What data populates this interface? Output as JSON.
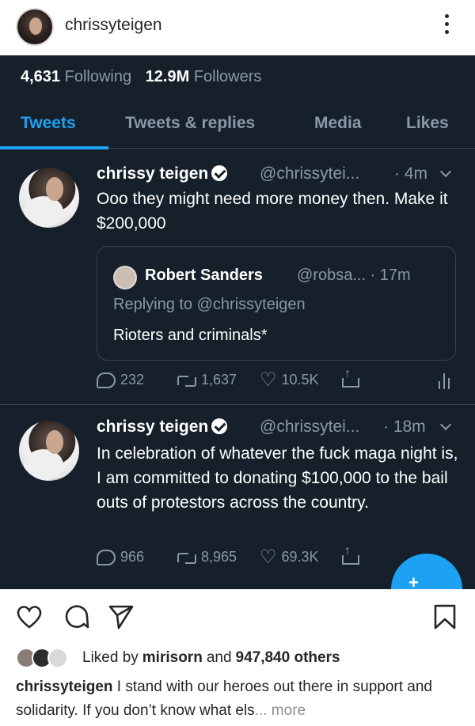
{
  "instagram": {
    "username": "chrissyteigen",
    "liked_prefix": "Liked by",
    "liked_user": "mirisorn",
    "liked_and": "and",
    "liked_count": "947,840 others",
    "caption_user": "chrissyteigen",
    "caption_text": "I stand with our heroes out there in support and solidarity. If you don’t know what els",
    "caption_more": "... more"
  },
  "twitter": {
    "following_count": "4,631",
    "following_label": "Following",
    "followers_count": "12.9M",
    "followers_label": "Followers",
    "tabs": [
      "Tweets",
      "Tweets & replies",
      "Media",
      "Likes"
    ],
    "tweets": [
      {
        "name": "chrissy teigen",
        "handle": "@chrissytei...",
        "time": "· 4m",
        "text": "Ooo they might need more money then. Make it $200,000",
        "quote": {
          "name": "Robert Sanders",
          "handle": "@robsa... · 17m",
          "replying_to": "Replying to @chrissyteigen",
          "text": "Rioters and criminals*"
        },
        "replies": "232",
        "retweets": "1,637",
        "likes": "10.5K"
      },
      {
        "name": "chrissy teigen",
        "handle": "@chrissytei...",
        "time": "· 18m",
        "text": "In celebration of whatever the fuck maga night is, I am committed to donating $100,000 to the bail outs of protestors across the country.",
        "replies": "966",
        "retweets": "8,965",
        "likes": "69.3K"
      }
    ],
    "fab_label": "+"
  },
  "colors": {
    "twitter_bg": "#15202b",
    "twitter_accent": "#1da1f2",
    "twitter_muted": "#8899a6",
    "ig_text": "#262626"
  }
}
